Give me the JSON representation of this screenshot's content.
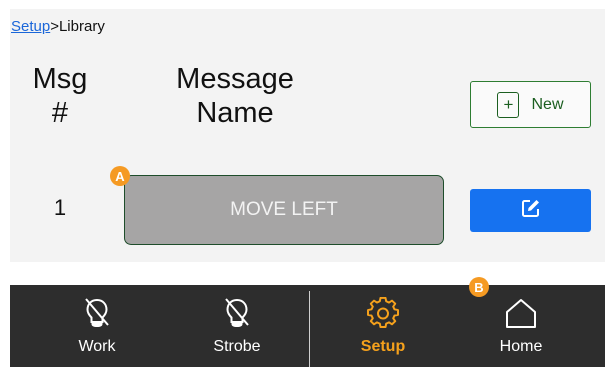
{
  "breadcrumb": {
    "link": "Setup",
    "separator": ">",
    "current": "Library"
  },
  "table": {
    "col_num_line1": "Msg",
    "col_num_line2": "#",
    "col_name_line1": "Message",
    "col_name_line2": "Name",
    "rows": [
      {
        "num": "1",
        "name": "MOVE LEFT"
      }
    ]
  },
  "new_button": {
    "label": "New",
    "icon": "plus-square-icon"
  },
  "edit_button": {
    "icon": "edit-icon"
  },
  "badges": {
    "a": "A",
    "b": "B"
  },
  "nav": {
    "items": [
      {
        "label": "Work",
        "icon": "light-off-icon",
        "active": false
      },
      {
        "label": "Strobe",
        "icon": "light-off-icon",
        "active": false
      },
      {
        "label": "Setup",
        "icon": "gear-icon",
        "active": true
      },
      {
        "label": "Home",
        "icon": "home-icon",
        "active": false
      }
    ]
  },
  "colors": {
    "accent": "#f5a11c",
    "edit_button": "#1672f0",
    "new_button_border": "#2e7d32",
    "nav_background": "#2d2d2d",
    "message_button": "#a6a5a5"
  }
}
